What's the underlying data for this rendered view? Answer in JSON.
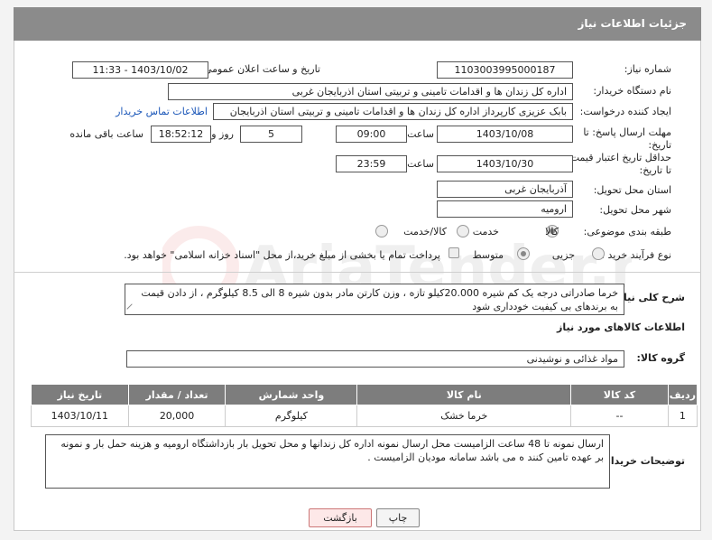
{
  "header": {
    "title": "جزئیات اطلاعات نیاز"
  },
  "fields": {
    "need_number_label": "شماره نیاز:",
    "need_number": "1103003995000187",
    "announce_label": "تاریخ و ساعت اعلان عمومی:",
    "announce_value": "1403/10/02 - 11:33",
    "buyer_label": "نام دستگاه خریدار:",
    "buyer_value": "اداره کل زندان ها و اقدامات تامینی و تربیتی استان اذربایجان غربی",
    "requester_label": "ایجاد کننده درخواست:",
    "requester_value": "بابک عزیزی کارپرداز اداره کل زندان ها و اقدامات تامینی و تربیتی استان اذربایجان",
    "contact_link": "اطلاعات تماس خریدار",
    "deadline_label": "مهلت ارسال پاسخ: تا تاریخ:",
    "deadline_date": "1403/10/08",
    "time_word": "ساعت",
    "deadline_time": "09:00",
    "days_value": "5",
    "days_word": "روز و",
    "remaining_time": "18:52:12",
    "remaining_word": "ساعت باقی مانده",
    "validity_label": "حداقل تاریخ اعتبار قیمت: تا تاریخ:",
    "validity_date": "1403/10/30",
    "validity_time": "23:59",
    "province_label": "استان محل تحویل:",
    "province_value": "آذربایجان غربی",
    "city_label": "شهر محل تحویل:",
    "city_value": "ارومیه",
    "category_label": "طبقه بندی موضوعی:",
    "category_options": [
      "کالا",
      "خدمت",
      "کالا/خدمت"
    ],
    "process_label": "نوع فرآیند خرید :",
    "process_options": [
      "جزیی",
      "متوسط"
    ],
    "payment_note": "پرداخت تمام یا بخشی از مبلغ خرید،از محل \"اسناد خزانه اسلامی\" خواهد بود."
  },
  "summary": {
    "label": "شرح کلی نیاز:",
    "text": "خرما صادراتی درجه یک کم شیره 20.000کیلو تازه ، وزن کارتن مادر بدون شیره 8 الی 8.5 کیلوگرم ، از دادن قیمت به برندهای بی کیفیت خودداری شود"
  },
  "goods": {
    "section_title": "اطلاعات کالاهای مورد نیاز",
    "group_label": "گروه کالا:",
    "group_value": "مواد غذائی و نوشیدنی",
    "columns": [
      "ردیف",
      "کد کالا",
      "نام کالا",
      "واحد شمارش",
      "تعداد / مقدار",
      "تاریخ نیاز"
    ],
    "rows": [
      [
        "1",
        "--",
        "خرما خشک",
        "کیلوگرم",
        "20,000",
        "1403/10/11"
      ]
    ]
  },
  "buyer_notes": {
    "label": "توضیحات خریدار:",
    "text": "ارسال نمونه تا 48 ساعت الزامیست محل ارسال نمونه اداره کل زندانها و محل تحویل بار بازداشتگاه ارومیه و هزینه حمل بار و نمونه بر عهده تامین کنند ه می باشد سامانه مودیان الزامیست ."
  },
  "buttons": {
    "print": "چاپ",
    "back": "بازگشت"
  },
  "watermark": {
    "text": "AriaTender.neT"
  },
  "colors": {
    "header_bg": "#8b8b8b",
    "table_header_bg": "#7d7d7d",
    "link": "#1a56b8"
  }
}
